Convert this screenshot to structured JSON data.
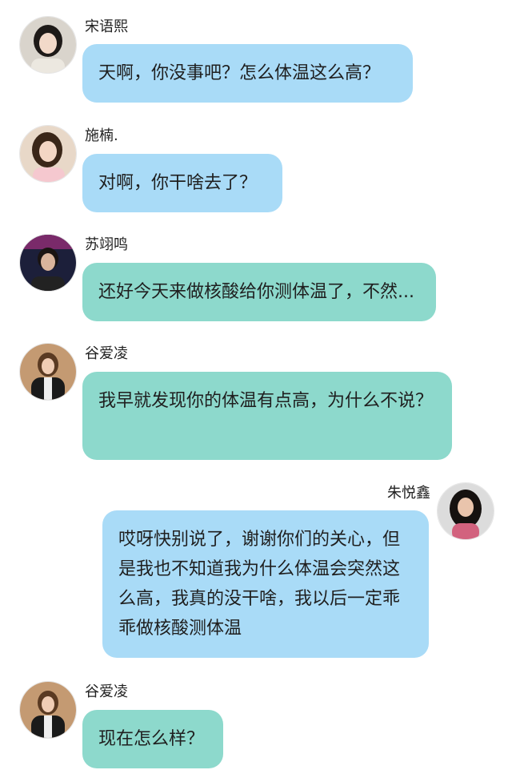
{
  "colors": {
    "blue_bubble": "#a9dbf7",
    "teal_bubble": "#8dd9cc",
    "background": "#ffffff"
  },
  "messages": [
    {
      "sender": "宋语熙",
      "text": "天啊，你没事吧？怎么体温这么高？",
      "side": "left",
      "bubble_color": "blue"
    },
    {
      "sender": "施楠.",
      "text": "对啊，你干啥去了？",
      "side": "left",
      "bubble_color": "blue"
    },
    {
      "sender": "苏翊鸣",
      "text": "还好今天来做核酸给你测体温了，不然...",
      "side": "left",
      "bubble_color": "teal"
    },
    {
      "sender": "谷爱凌",
      "text": "我早就发现你的体温有点高，为什么不说？",
      "side": "left",
      "bubble_color": "teal"
    },
    {
      "sender": "朱悦鑫",
      "text": "哎呀快别说了，谢谢你们的关心，但是我也不知道我为什么体温会突然这么高，我真的没干啥，我以后一定乖乖做核酸测体温",
      "side": "right",
      "bubble_color": "blue"
    },
    {
      "sender": "谷爱凌",
      "text": "现在怎么样？",
      "side": "left",
      "bubble_color": "teal"
    }
  ]
}
